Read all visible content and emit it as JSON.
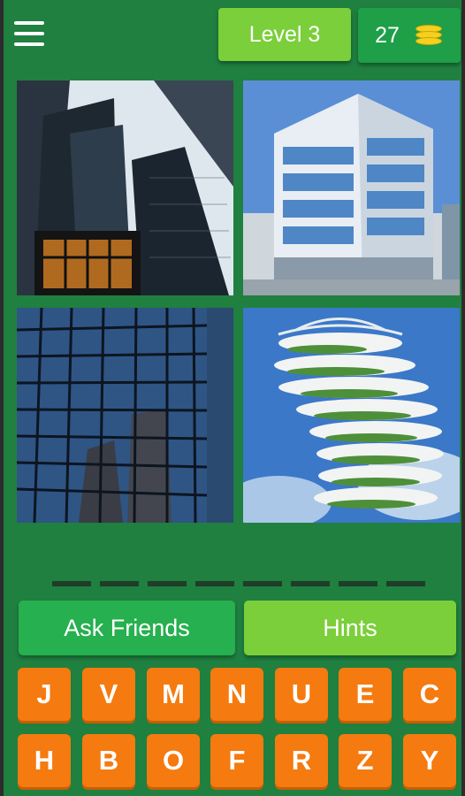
{
  "header": {
    "level_label": "Level 3",
    "coins": "27"
  },
  "pictures": [
    {
      "name": "skyscrapers-looking-up"
    },
    {
      "name": "modern-office-building"
    },
    {
      "name": "glass-curtain-wall"
    },
    {
      "name": "green-tower-building"
    }
  ],
  "answer": {
    "slot_count": 8
  },
  "actions": {
    "ask_friends": "Ask Friends",
    "hints": "Hints"
  },
  "keyboard": {
    "row1": [
      "J",
      "V",
      "M",
      "N",
      "U",
      "E",
      "C"
    ],
    "row2": [
      "H",
      "B",
      "O",
      "F",
      "R",
      "Z",
      "Y"
    ]
  },
  "colors": {
    "background": "#1f8040",
    "level_box": "#7bcf3a",
    "coin_box": "#1e9f48",
    "key": "#f57a0f",
    "ask_button": "#26b04f",
    "hints_button": "#7bcf3a",
    "coin": "#f5d020"
  }
}
